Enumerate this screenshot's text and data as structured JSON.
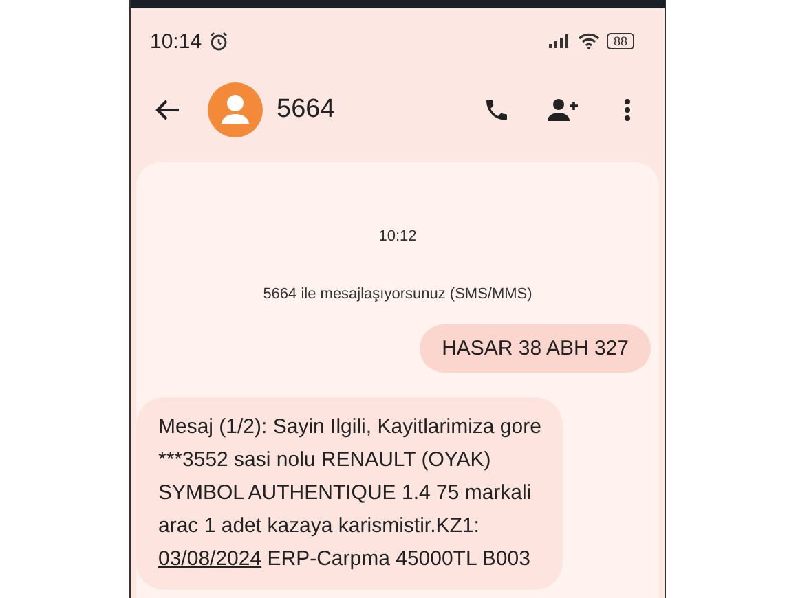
{
  "status_bar": {
    "time": "10:14",
    "alarm": true,
    "battery": "88"
  },
  "header": {
    "contact": "5664"
  },
  "conversation": {
    "timestamp": "10:12",
    "info": "5664 ile mesajlaşıyorsunuz (SMS/MMS)",
    "messages": [
      {
        "kind": "sent",
        "lines": [
          "HASAR 38 ABH 327"
        ]
      },
      {
        "kind": "received",
        "lines": [
          "Mesaj (1/2): Sayin Ilgili, Kayitlarimiza gore",
          "***3552 sasi nolu RENAULT (OYAK)",
          "SYMBOL AUTHENTIQUE 1.4 75 markali",
          "arac 1 adet kazaya karismistir.KZ1:"
        ],
        "link": "03/08/2024",
        "tail": " ERP-Carpma 45000TL B003"
      }
    ]
  }
}
